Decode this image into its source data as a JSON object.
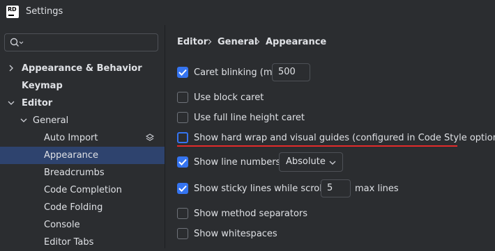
{
  "window": {
    "title": "Settings",
    "logo_text": "RD"
  },
  "search": {
    "value": ""
  },
  "sidebar": {
    "items": [
      {
        "label": "Appearance & Behavior",
        "level": 0,
        "expandable": true,
        "expanded": false,
        "bold": true
      },
      {
        "label": "Keymap",
        "level": 0,
        "expandable": false,
        "bold": true
      },
      {
        "label": "Editor",
        "level": 0,
        "expandable": true,
        "expanded": true,
        "bold": true
      },
      {
        "label": "General",
        "level": 1,
        "expandable": true,
        "expanded": true
      },
      {
        "label": "Auto Import",
        "level": 2,
        "icon": "layers-icon"
      },
      {
        "label": "Appearance",
        "level": 2,
        "selected": true
      },
      {
        "label": "Breadcrumbs",
        "level": 2
      },
      {
        "label": "Code Completion",
        "level": 2
      },
      {
        "label": "Code Folding",
        "level": 2
      },
      {
        "label": "Console",
        "level": 2
      },
      {
        "label": "Editor Tabs",
        "level": 2
      }
    ]
  },
  "breadcrumb": [
    "Editor",
    "General",
    "Appearance"
  ],
  "options": {
    "caret_blinking": {
      "label": "Caret blinking (ms):",
      "checked": true,
      "value": "500"
    },
    "block_caret": {
      "label": "Use block caret",
      "checked": false
    },
    "full_line_height": {
      "label": "Use full line height caret",
      "checked": false
    },
    "hard_wrap": {
      "label": "Show hard wrap and visual guides (configured in Code Style options)",
      "checked": false,
      "focused": true
    },
    "line_numbers": {
      "label": "Show line numbers:",
      "checked": true,
      "value": "Absolute"
    },
    "sticky_lines": {
      "label": "Show sticky lines while scrolling:",
      "checked": true,
      "value": "5",
      "suffix": "max lines"
    },
    "method_separators": {
      "label": "Show method separators",
      "checked": false
    },
    "whitespaces": {
      "label": "Show whitespaces",
      "checked": false
    }
  },
  "colors": {
    "accent": "#3574f0",
    "selection": "#2e436e",
    "highlight_underline": "#e32b2b",
    "background": "#2b2d30"
  }
}
